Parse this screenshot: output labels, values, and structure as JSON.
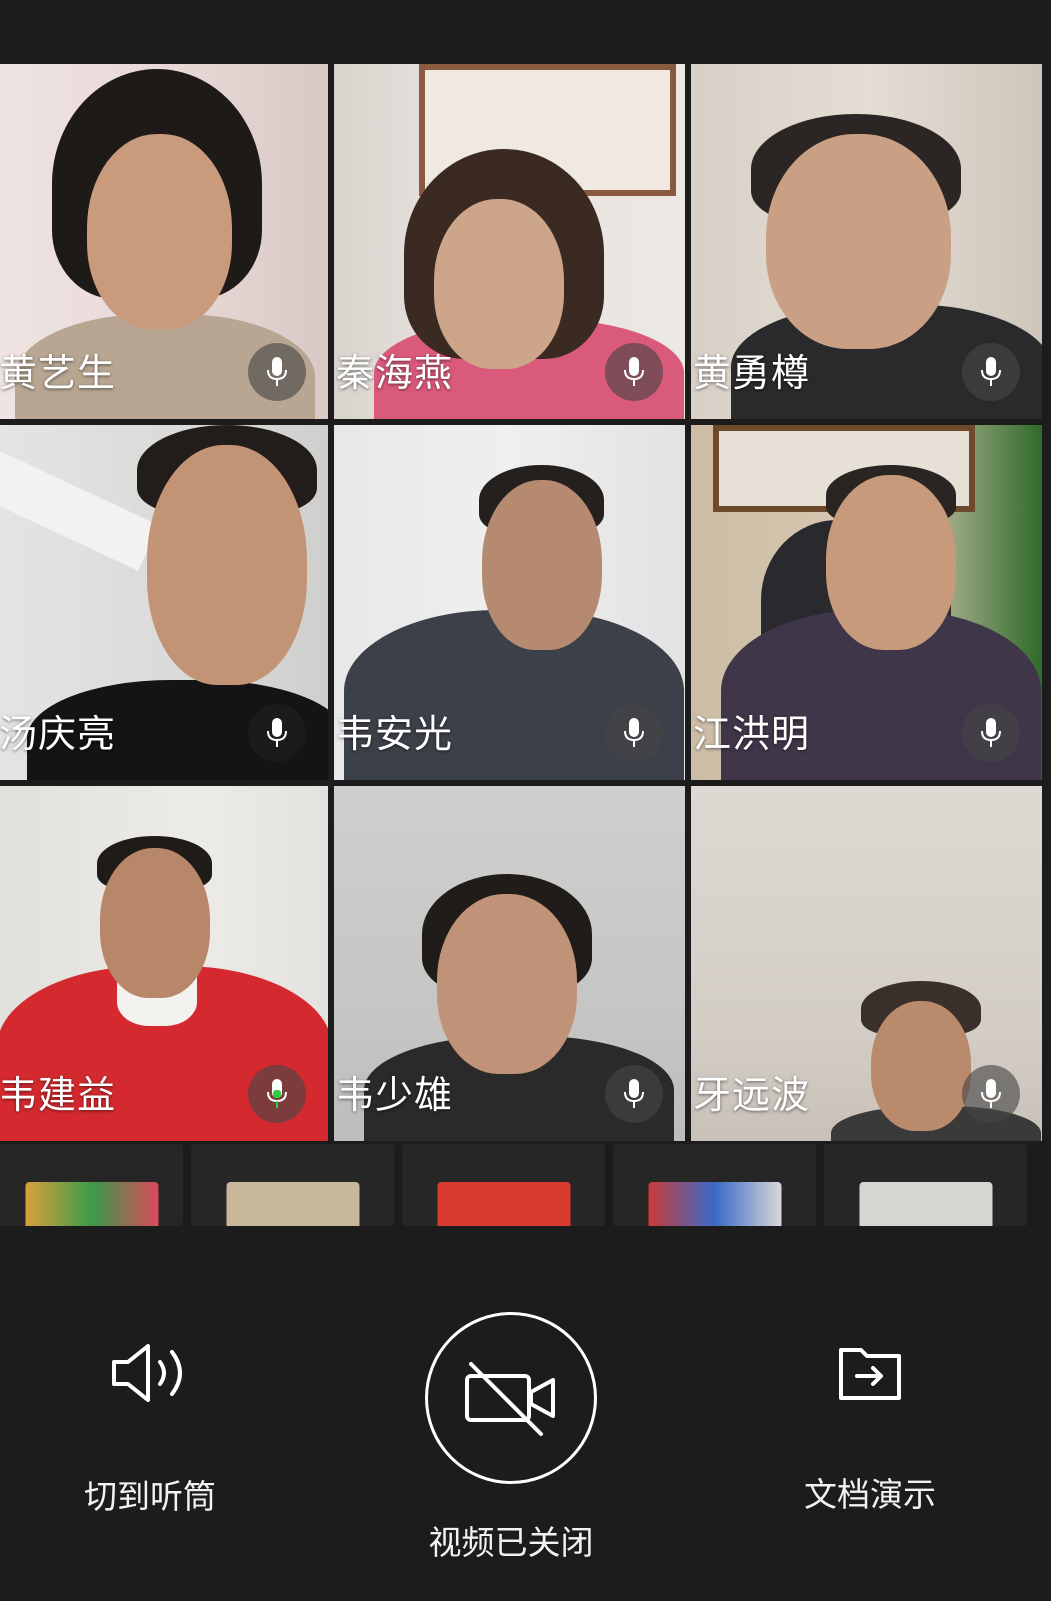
{
  "participants": [
    {
      "name": "黄艺生",
      "mic_active": false
    },
    {
      "name": "秦海燕",
      "mic_active": false
    },
    {
      "name": "黄勇樽",
      "mic_active": false
    },
    {
      "name": "汤庆亮",
      "mic_active": false
    },
    {
      "name": "韦安光",
      "mic_active": false
    },
    {
      "name": "江洪明",
      "mic_active": false
    },
    {
      "name": "韦建益",
      "mic_active": true
    },
    {
      "name": "韦少雄",
      "mic_active": false
    },
    {
      "name": "牙远波",
      "mic_active": false
    }
  ],
  "controls": {
    "speaker_label": "切到听筒",
    "video_label": "视频已关闭",
    "doc_label": "文档演示"
  },
  "colors": {
    "background": "#1c1c1c",
    "mic_active": "#2ecc40",
    "label": "#f2f2f2"
  },
  "icons": [
    "mic-icon",
    "speaker-icon",
    "video-off-icon",
    "share-document-icon"
  ]
}
